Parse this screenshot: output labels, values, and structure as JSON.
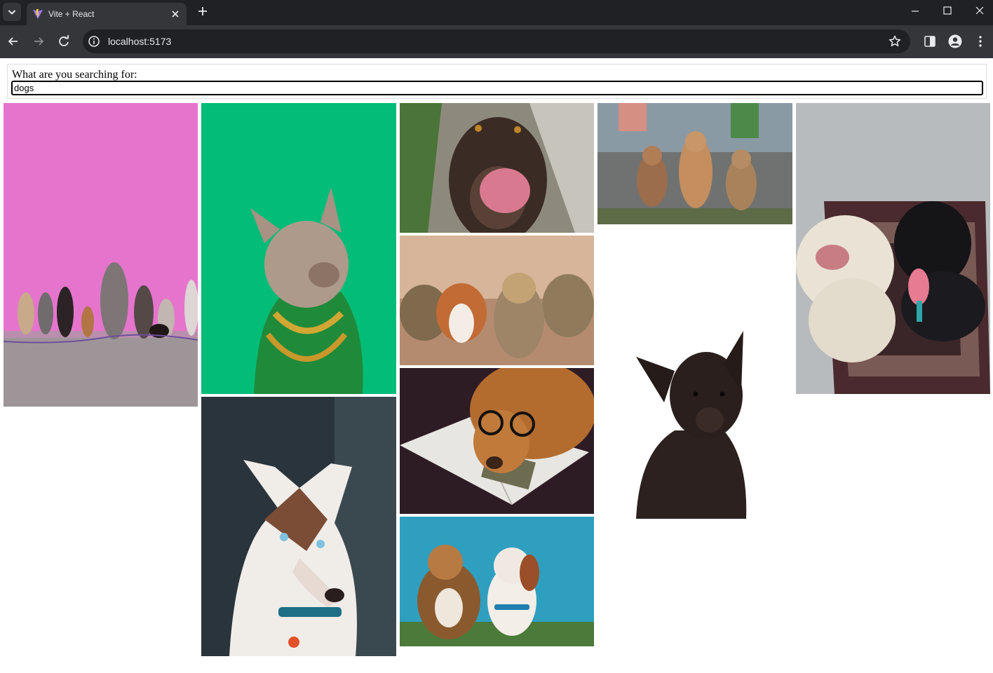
{
  "browser": {
    "tab_title": "Vite + React",
    "url": "localhost:5173"
  },
  "search": {
    "label": "What are you searching for:",
    "value": "dogs"
  },
  "images": [
    {
      "name": "photo-dogs-pink-wall",
      "icon": "dogs-lineup-photo"
    },
    {
      "name": "photo-french-bulldog-green",
      "icon": "french-bulldog-photo"
    },
    {
      "name": "photo-husky",
      "icon": "husky-photo"
    },
    {
      "name": "photo-labrador-tongue",
      "icon": "labrador-photo"
    },
    {
      "name": "photo-corgi-yorkie-running",
      "icon": "running-dogs-photo"
    },
    {
      "name": "photo-dog-glasses-magazine",
      "icon": "dog-glasses-photo"
    },
    {
      "name": "photo-two-dogs-sky",
      "icon": "dogs-sky-photo"
    },
    {
      "name": "photo-three-puppies",
      "icon": "puppies-photo"
    },
    {
      "name": "photo-black-dog-white",
      "icon": "black-dog-photo"
    },
    {
      "name": "photo-white-and-black-dog-rug",
      "icon": "dogs-rug-photo"
    }
  ],
  "colors": {
    "chrome_dark": "#202124",
    "chrome_toolbar": "#35363a",
    "chrome_text": "#e8eaed"
  }
}
